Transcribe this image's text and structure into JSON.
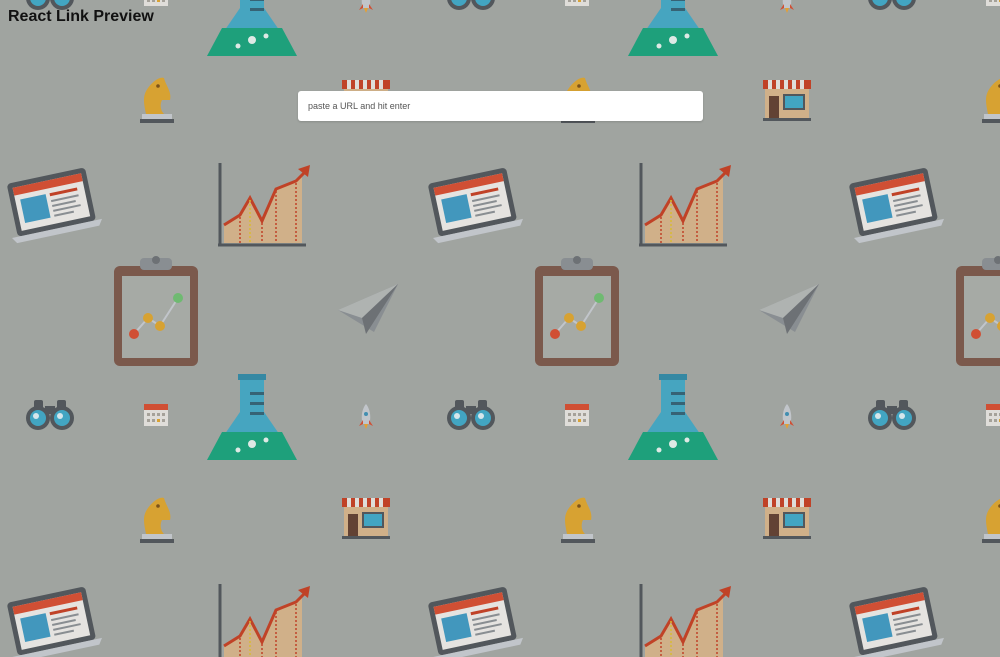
{
  "app": {
    "title": "React Link Preview"
  },
  "search": {
    "placeholder": "paste a URL and hit enter",
    "value": ""
  },
  "background": {
    "pattern_icons": [
      "flask-icon",
      "rocket-icon",
      "calendar-icon",
      "binoculars-icon",
      "chess-knight-icon",
      "store-icon",
      "laptop-icon",
      "growth-chart-icon",
      "clipboard-chart-icon",
      "paper-plane-icon"
    ],
    "colors": {
      "background": "#a3a7a3",
      "flask": "#3aa9c9",
      "flask_liquid": "#12a37a",
      "chart_bars": "#d9b58a",
      "chart_line": "#c73a1c",
      "clipboard": "#7a5446",
      "knight": "#e0a529",
      "laptop_screen": "#3a99c3",
      "laptop_header": "#d8492b"
    }
  }
}
